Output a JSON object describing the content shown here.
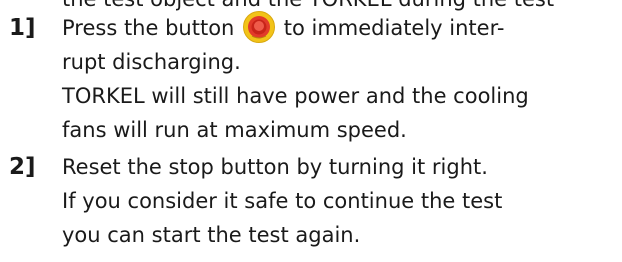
{
  "header_fragment": "the test object and the TORKEL during the test",
  "steps": [
    {
      "number": "1]",
      "lines": [
        {
          "before_icon": "Press the button",
          "after_icon": "to immediately inter-"
        },
        "rupt discharging.",
        "TORKEL will still have power and the cooling",
        "fans will run at maximum speed."
      ],
      "icon": "emergency-stop-icon"
    },
    {
      "number": "2]",
      "lines": [
        "Reset the stop button by turning it right.",
        "If you consider it safe to continue the test",
        "you can start the test again."
      ]
    }
  ],
  "colors": {
    "text": "#1a1a1a",
    "stop_button_red": "#e23a2a",
    "stop_button_yellow": "#f2c318"
  }
}
